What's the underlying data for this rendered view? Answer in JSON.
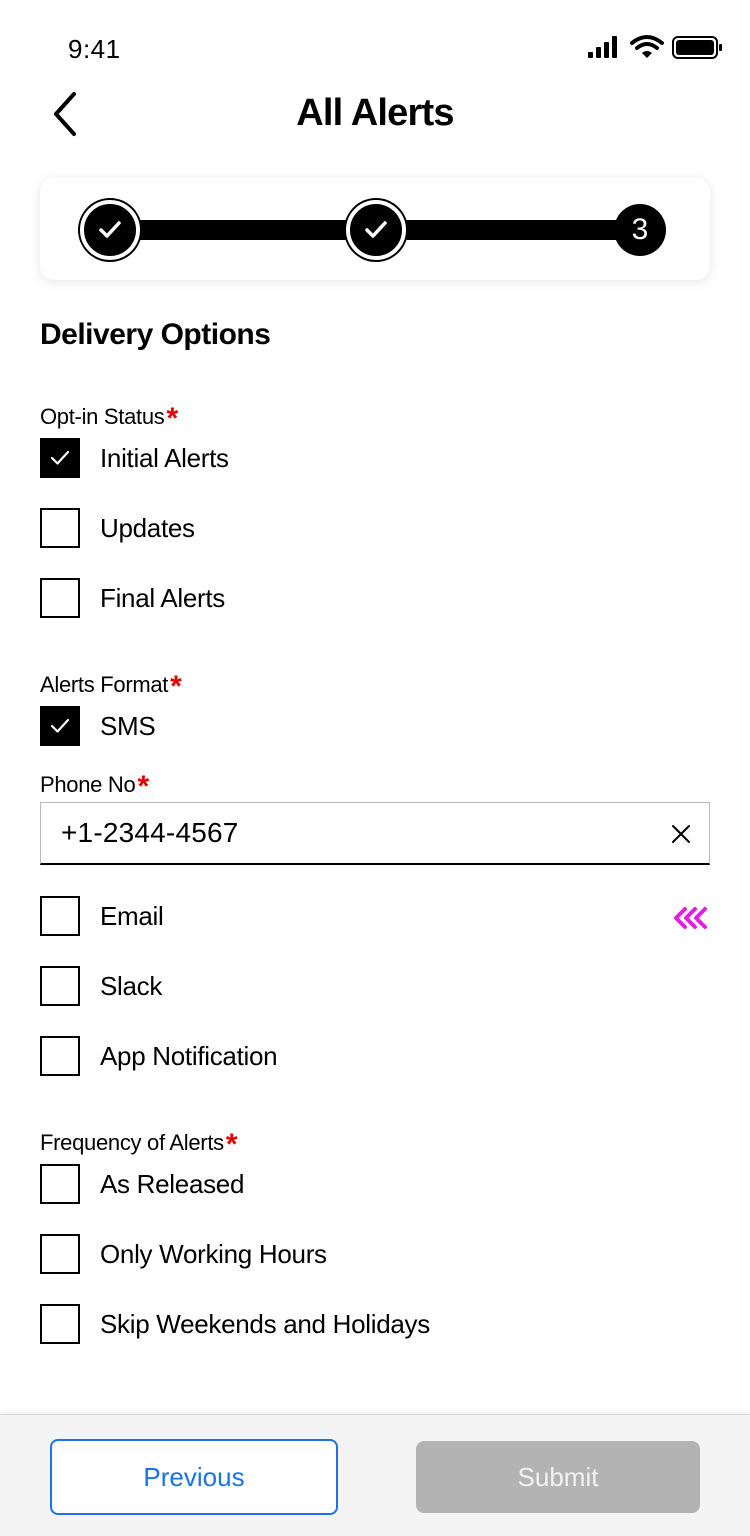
{
  "status_bar": {
    "time": "9:41",
    "icons": [
      "signal-icon",
      "wifi-icon",
      "battery-icon"
    ]
  },
  "header": {
    "title": "All Alerts",
    "back_icon": "chevron-left-icon"
  },
  "stepper": {
    "steps": [
      {
        "state": "complete",
        "label": ""
      },
      {
        "state": "complete",
        "label": ""
      },
      {
        "state": "current",
        "label": "3"
      }
    ]
  },
  "section": {
    "title": "Delivery Options"
  },
  "opt_in": {
    "label": "Opt-in Status",
    "required_mark": "*",
    "options": [
      {
        "label": "Initial Alerts",
        "checked": true
      },
      {
        "label": "Updates",
        "checked": false
      },
      {
        "label": "Final Alerts",
        "checked": false
      }
    ]
  },
  "format": {
    "label": "Alerts Format",
    "required_mark": "*",
    "sms": {
      "label": "SMS",
      "checked": true
    },
    "phone": {
      "label": "Phone No",
      "required_mark": "*",
      "value": "+1-2344-4567"
    },
    "others": [
      {
        "label": "Email",
        "checked": false
      },
      {
        "label": "Slack",
        "checked": false
      },
      {
        "label": "App Notification",
        "checked": false
      }
    ]
  },
  "frequency": {
    "label": "Frequency of Alerts",
    "required_mark": "*",
    "options": [
      {
        "label": "As Released",
        "checked": false
      },
      {
        "label": "Only Working Hours",
        "checked": false
      },
      {
        "label": "Skip Weekends and Holidays",
        "checked": false
      }
    ]
  },
  "footer": {
    "previous_label": "Previous",
    "submit_label": "Submit"
  },
  "colors": {
    "required": "#e60000",
    "accent_blue": "#1a73e8",
    "disabled": "#b3b3b3",
    "chevron_magenta": "#e020e0"
  }
}
